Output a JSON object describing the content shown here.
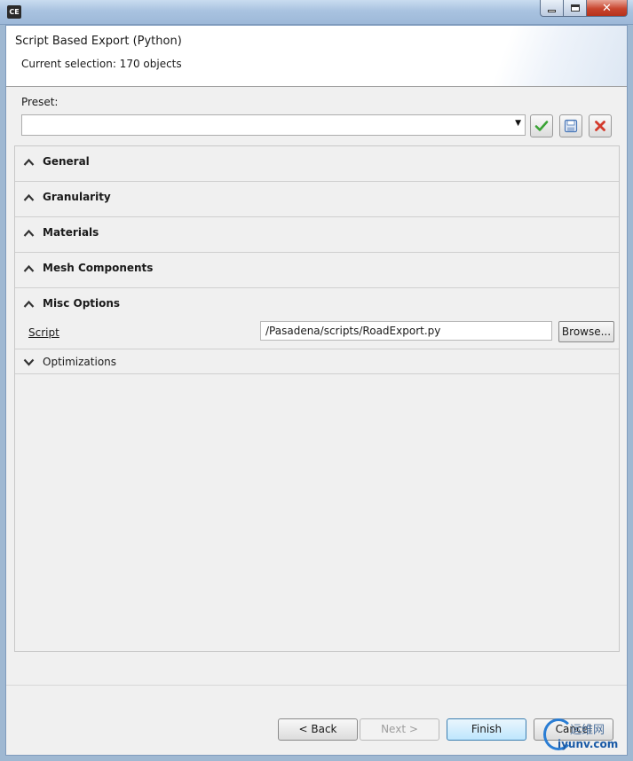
{
  "window": {
    "logo_text": "CE",
    "close_glyph": "✕"
  },
  "header": {
    "title": "Script Based Export (Python)",
    "subtitle": "Current selection: 170 objects"
  },
  "preset": {
    "label": "Preset:",
    "value": "",
    "arrow": "▼"
  },
  "sections": [
    {
      "label": "General",
      "expanded": true
    },
    {
      "label": "Granularity",
      "expanded": true
    },
    {
      "label": "Materials",
      "expanded": true
    },
    {
      "label": "Mesh Components",
      "expanded": true
    },
    {
      "label": "Misc Options",
      "expanded": true
    },
    {
      "label": "Optimizations",
      "expanded": false
    }
  ],
  "misc_options": {
    "script_label": "Script",
    "script_value": "/Pasadena/scripts/RoadExport.py",
    "browse_label": "Browse..."
  },
  "footer": {
    "back_label": "< Back",
    "next_label": "Next >",
    "finish_label": "Finish",
    "cancel_label": "Cancel"
  },
  "watermark": {
    "line1": "运维网",
    "line2": "iyunv.com"
  },
  "colors": {
    "accent_check": "#3aa335",
    "accent_delete": "#d33a2c",
    "accent_save": "#4a78b8",
    "titlebar": "#a9c3e0"
  },
  "icons": {
    "apply": "check-icon",
    "save": "floppy-disk-icon",
    "delete": "x-icon"
  }
}
